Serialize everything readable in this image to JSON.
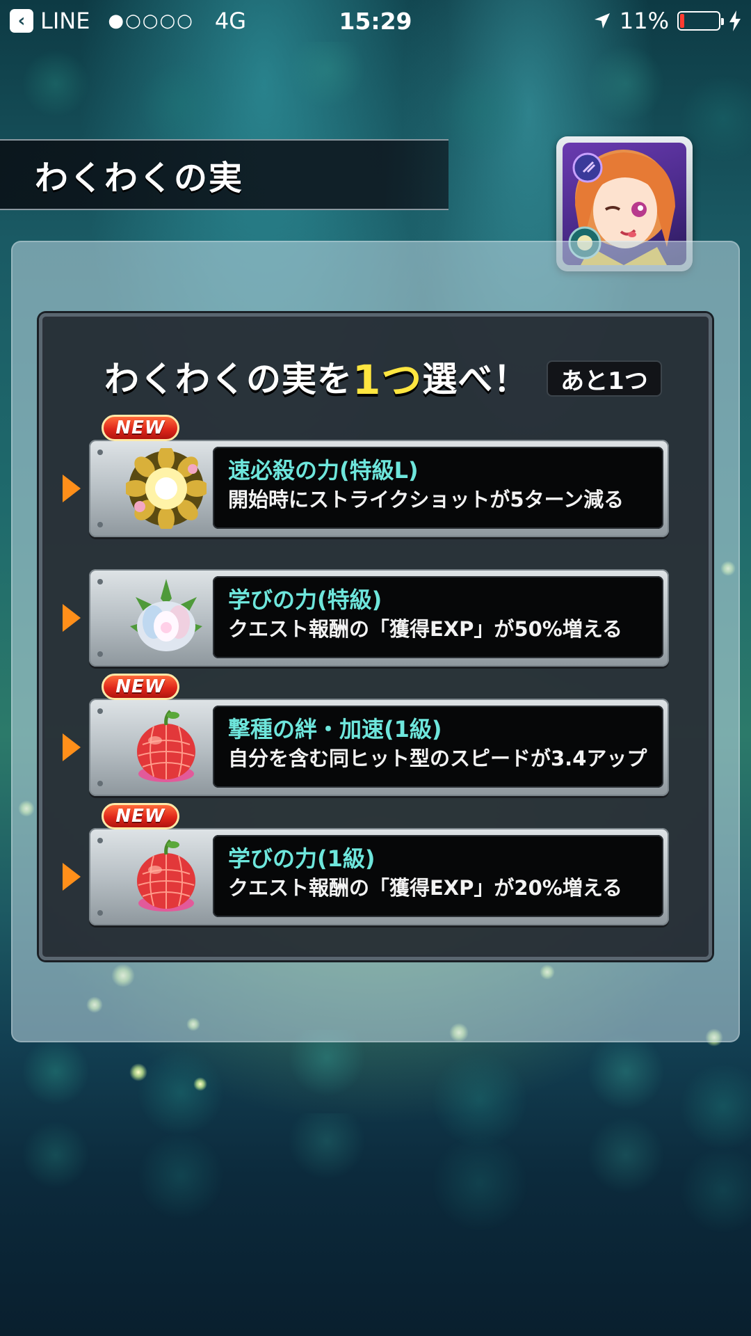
{
  "status_bar": {
    "back_app": "LINE",
    "signal": "●○○○○",
    "network": "4G",
    "time": "15:29",
    "battery_percent": "11%",
    "battery_level": 0.11
  },
  "title": "わくわくの実",
  "dialog": {
    "heading_prefix": "わくわくの実を",
    "heading_number": "1つ",
    "heading_suffix": "選べ！",
    "remaining": "あと1つ"
  },
  "choices": [
    {
      "name": "速必殺の力(特級L)",
      "description": "開始時にストライクショットが5ターン減る",
      "badge": "NEW",
      "icon": "golden-flower-fruit-icon"
    },
    {
      "name": "学びの力(特級)",
      "description": "クエスト報酬の「獲得EXP」が50%増える",
      "badge": "",
      "icon": "crystal-lotus-fruit-icon"
    },
    {
      "name": "撃種の絆・加速(1級)",
      "description": "自分を含む同ヒット型のスピードが3.4アップ",
      "badge": "NEW",
      "icon": "red-fruit-icon"
    },
    {
      "name": "学びの力(1級)",
      "description": "クエスト報酬の「獲得EXP」が20%増える",
      "badge": "NEW",
      "icon": "red-fruit-icon"
    }
  ],
  "colors": {
    "accent_yellow": "#ffe640",
    "name_cyan": "#6ee6dc",
    "arrow_orange": "#ff8f1a",
    "badge_red": "#e0281b"
  }
}
